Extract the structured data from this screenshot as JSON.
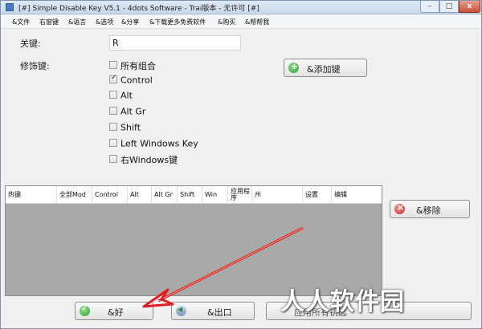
{
  "window": {
    "title": "[#] Simple Disable Key V5.1 - 4dots Software - Trai版本 - 无许可 [#]",
    "controls": {
      "minimize": "–",
      "maximize": "□",
      "close": "x"
    }
  },
  "menu": {
    "items": [
      "&文件",
      "右窗键",
      "&语言",
      "&选项",
      "&分享",
      "&下载更多免费软件",
      "&购买",
      "&帮帮我"
    ]
  },
  "form": {
    "key_label": "关键:",
    "key_value": "R",
    "modifier_label": "修饰键:",
    "modifiers": [
      {
        "label": "所有组合",
        "checked": false
      },
      {
        "label": "Control",
        "checked": true
      },
      {
        "label": "Alt",
        "checked": false
      },
      {
        "label": "Alt Gr",
        "checked": false
      },
      {
        "label": "Shift",
        "checked": false
      },
      {
        "label": "Left Windows Key",
        "checked": false
      },
      {
        "label": "右Windows键",
        "checked": false
      }
    ],
    "add_key_button": "&添加键"
  },
  "table": {
    "columns": [
      "热键",
      "全部Mod",
      "Control",
      "Alt",
      "Alt Gr",
      "Shift",
      "Win",
      "应用程序",
      "州",
      "设置",
      "编辑"
    ],
    "rows": []
  },
  "buttons": {
    "remove": "&移除",
    "ok": "&好",
    "exit": "&出口",
    "apply_fragment": "应用所有钥匙"
  },
  "watermark": "人人软件园",
  "colors": {
    "list_background": "#a9a9a9",
    "arrow": "#e02020",
    "window_border": "#7f93ad"
  }
}
